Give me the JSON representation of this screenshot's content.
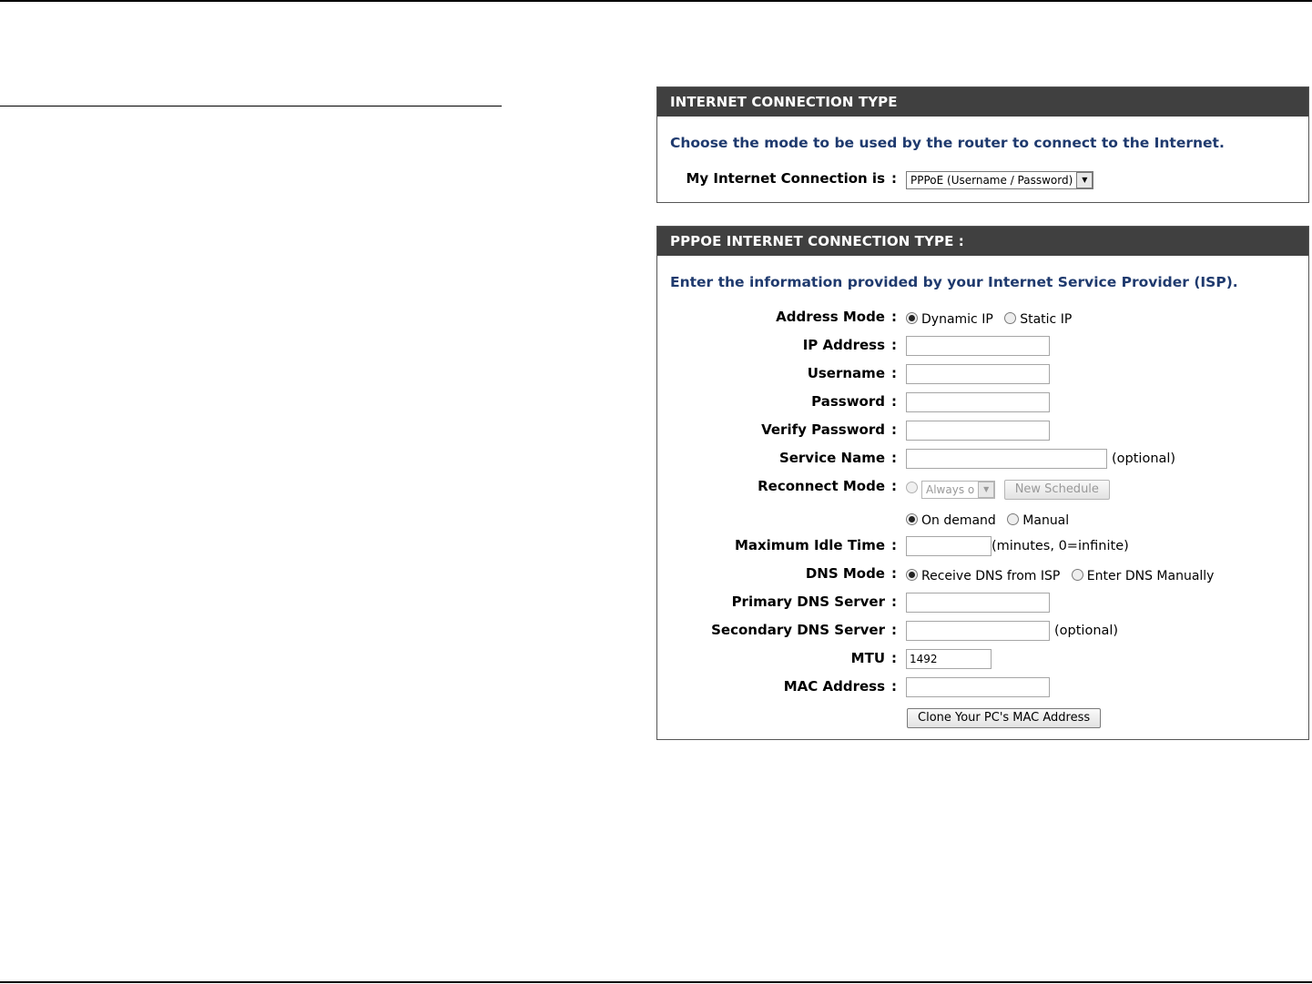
{
  "panel1": {
    "header": "INTERNET CONNECTION TYPE",
    "intro": "Choose the mode to be used by the router to connect to the Internet.",
    "connection_label": "My Internet Connection is",
    "connection_value": "PPPoE (Username / Password)"
  },
  "panel2": {
    "header": "PPPOE INTERNET CONNECTION TYPE :",
    "intro": "Enter the information provided by your Internet Service Provider (ISP).",
    "colon": ":",
    "address_mode": {
      "label": "Address Mode",
      "opt1": "Dynamic IP",
      "opt2": "Static IP"
    },
    "ip_address": {
      "label": "IP Address",
      "value": ""
    },
    "username": {
      "label": "Username",
      "value": ""
    },
    "password": {
      "label": "Password",
      "value": ""
    },
    "verify_password": {
      "label": "Verify Password",
      "value": ""
    },
    "service_name": {
      "label": "Service Name",
      "value": "",
      "note": "(optional)"
    },
    "reconnect_mode": {
      "label": "Reconnect Mode",
      "schedule_value": "Always o",
      "new_schedule_button": "New Schedule",
      "opt_on_demand": "On demand",
      "opt_manual": "Manual"
    },
    "max_idle_time": {
      "label": "Maximum Idle Time",
      "value": "",
      "note": "(minutes, 0=infinite)"
    },
    "dns_mode": {
      "label": "DNS Mode",
      "opt1": "Receive DNS from ISP",
      "opt2": "Enter DNS Manually"
    },
    "primary_dns": {
      "label": "Primary DNS Server",
      "value": ""
    },
    "secondary_dns": {
      "label": "Secondary DNS Server",
      "value": "",
      "note": "(optional)"
    },
    "mtu": {
      "label": "MTU",
      "value": "1492"
    },
    "mac_address": {
      "label": "MAC Address",
      "value": ""
    },
    "clone_button": "Clone Your PC's MAC Address"
  }
}
